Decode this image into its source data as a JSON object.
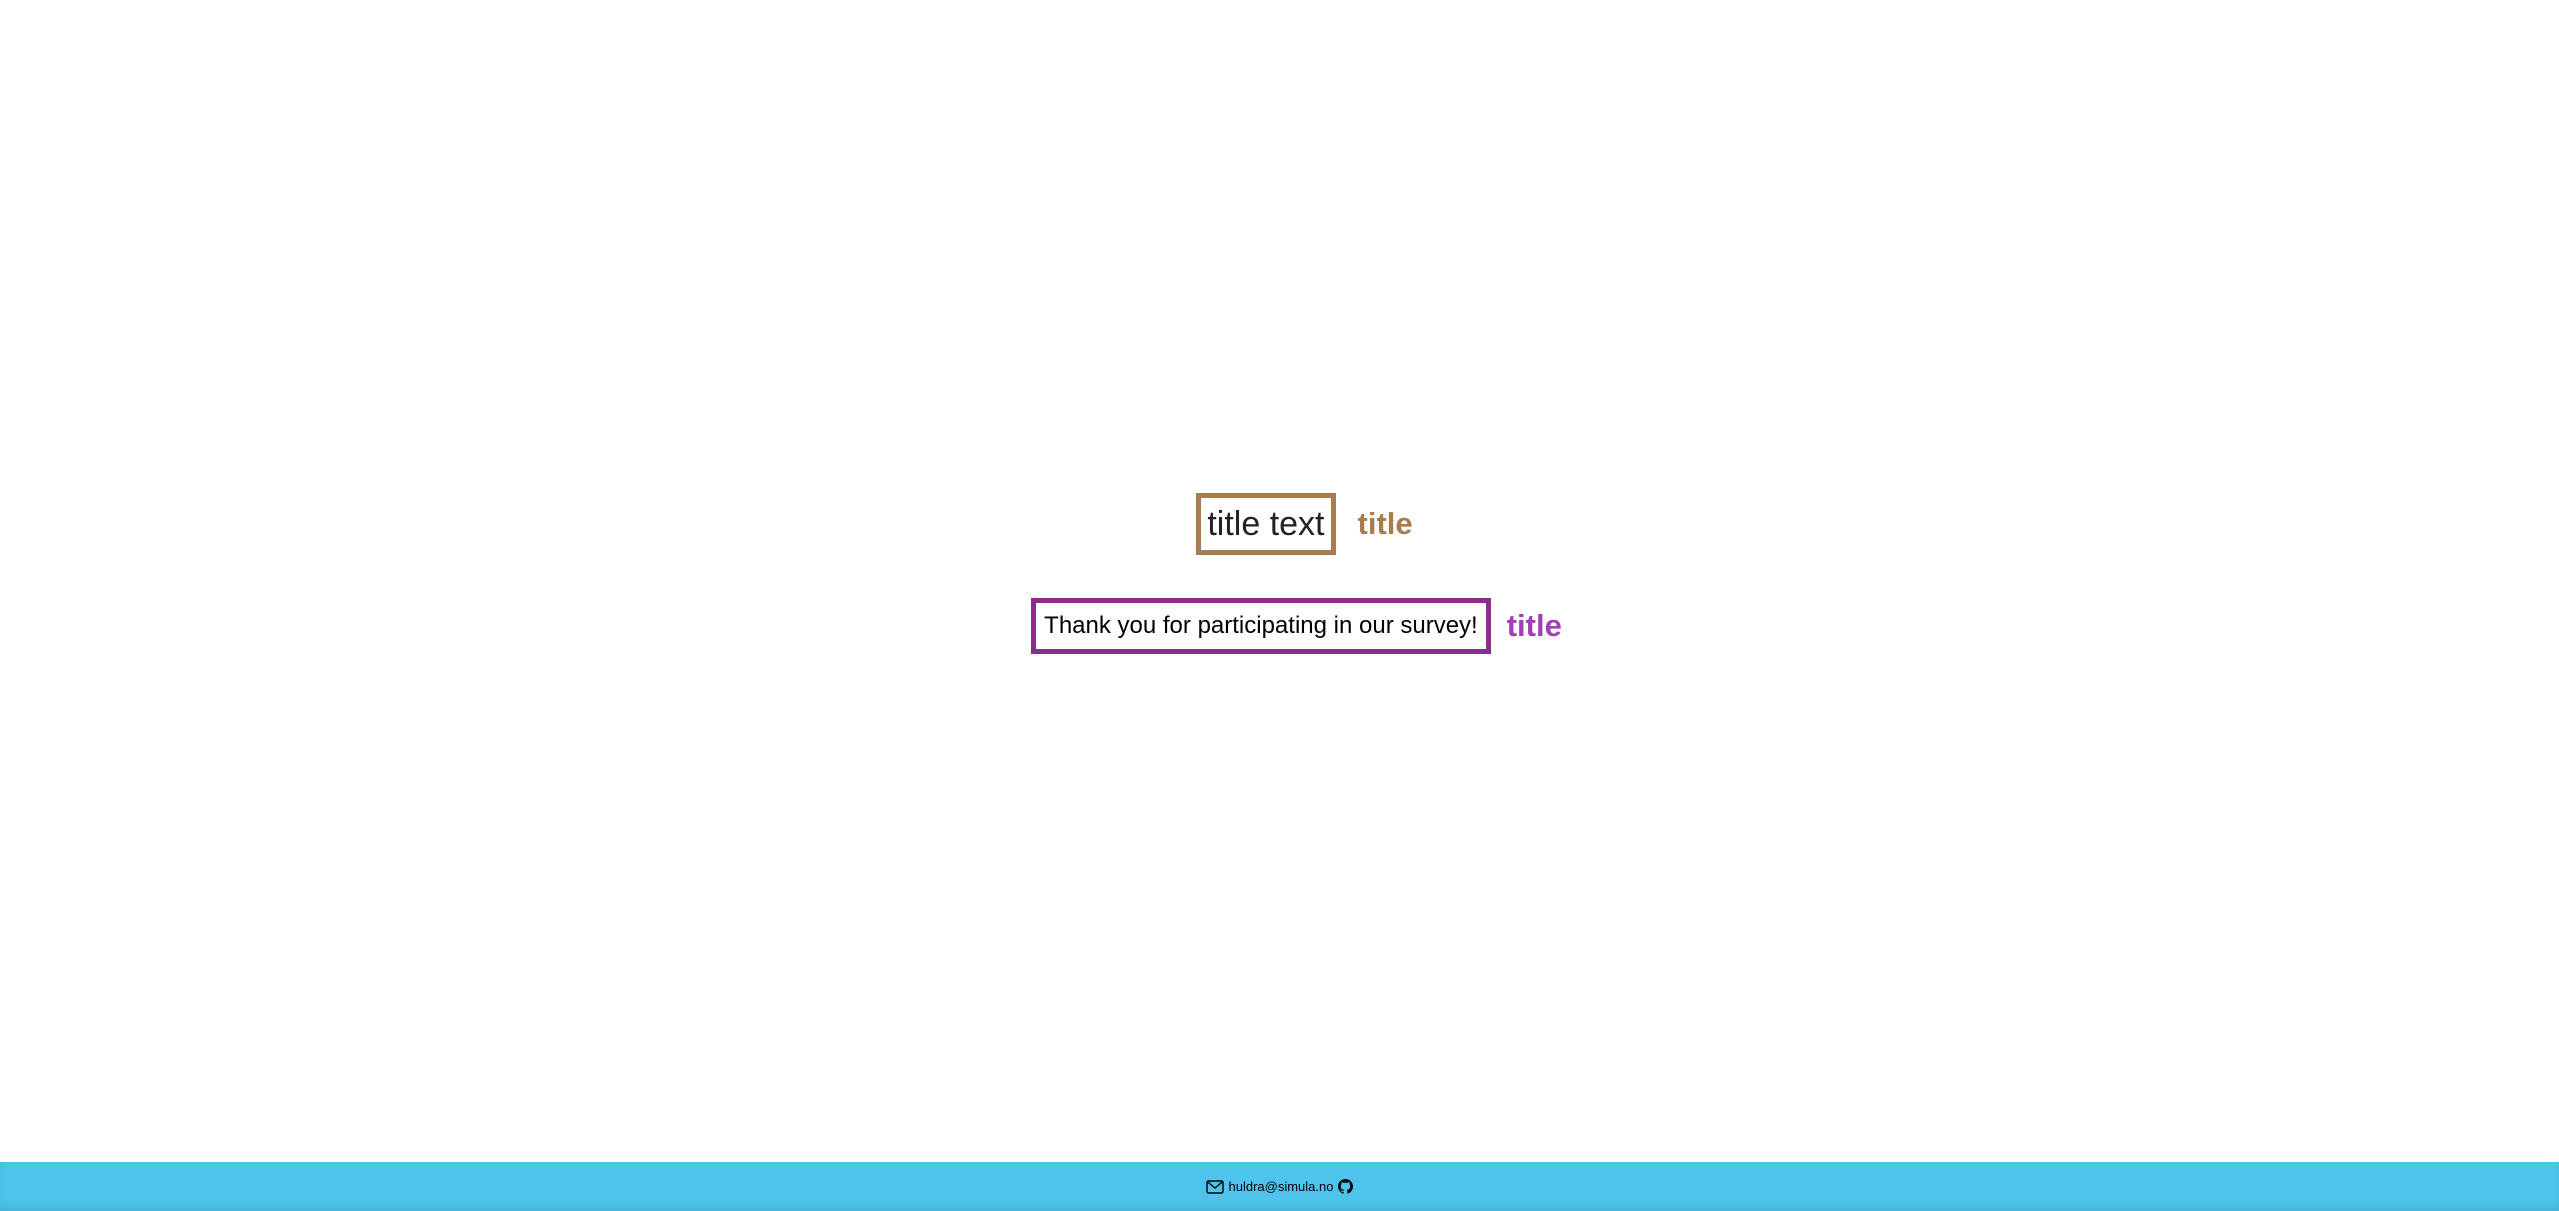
{
  "main": {
    "field_one": {
      "box_text": "title text",
      "label": "title",
      "accent_color": "#a87c4f"
    },
    "field_two": {
      "box_text": "Thank you for participating in our survey!",
      "label": "title",
      "accent_color": "#8e2b8e"
    }
  },
  "footer": {
    "email": "huldra@simula.no",
    "background_color": "#4ec3ec",
    "icons": [
      "mail-icon",
      "github-icon"
    ]
  }
}
